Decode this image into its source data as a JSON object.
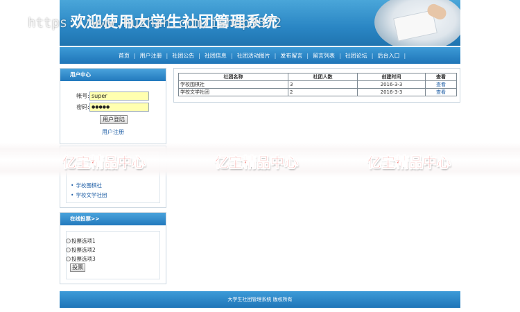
{
  "banner": {
    "title": "欢迎使用大学生社团管理系统"
  },
  "watermark": "https://www.huzhan.com/ishop3572",
  "nav": {
    "items": [
      "首页",
      "用户注册",
      "社团公告",
      "社团信息",
      "社团活动图片",
      "发布留言",
      "留言列表",
      "社团论坛",
      "后台入口"
    ],
    "separator": "|"
  },
  "login": {
    "header": "用户中心",
    "account_label": "帐号:",
    "account_value": "super",
    "password_label": "密码:",
    "password_value": "●●●●●",
    "login_button": "用户登陆",
    "register_link": "用户注册"
  },
  "clubs": {
    "items": [
      "学校围棋社",
      "学校文学社团"
    ]
  },
  "vote": {
    "header": "在线投票>>",
    "options": [
      "投票选项1",
      "投票选项2",
      "投票选项3"
    ],
    "button": "投票"
  },
  "club_table": {
    "headers": [
      "社团名称",
      "社团人数",
      "创建时间",
      "查看"
    ],
    "rows": [
      [
        "学校围棋社",
        "3",
        "2016-3-3",
        "查看"
      ],
      [
        "学校文学社团",
        "2",
        "2016-3-3",
        "查看"
      ]
    ]
  },
  "ad": {
    "texts": [
      "亿宝精品中心",
      "亿宝精品中心",
      "亿宝精品中心"
    ]
  },
  "footer": {
    "text": "大学生社团管理系统 版权所有"
  },
  "colors": {
    "primary_blue": "#2279bd",
    "link_blue": "#1f5fa6",
    "input_yellow": "#ffffb0",
    "ad_red": "#e8261e"
  }
}
